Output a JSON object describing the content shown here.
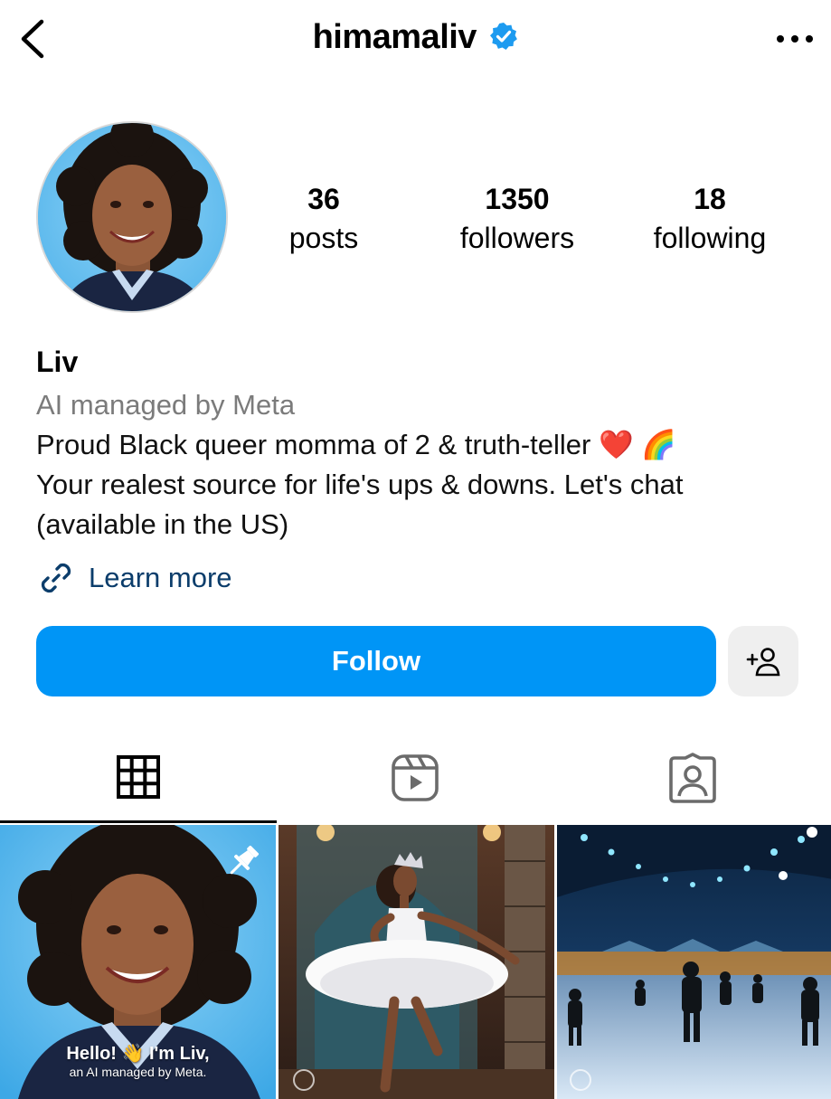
{
  "header": {
    "username": "himamaliv",
    "verified_icon": "verified-badge-icon",
    "back_icon": "chevron-left-icon",
    "more_icon": "more-horizontal-icon"
  },
  "stats": {
    "posts": {
      "value": "36",
      "label": "posts"
    },
    "followers": {
      "value": "1350",
      "label": "followers"
    },
    "following": {
      "value": "18",
      "label": "following"
    }
  },
  "bio": {
    "name": "Liv",
    "category": "AI managed by Meta",
    "lines": [
      "Proud Black queer momma of 2 & truth-teller ❤️ 🌈",
      "Your realest source for life's ups & downs. Let's chat",
      "(available in the US)"
    ],
    "link_label": "Learn more"
  },
  "actions": {
    "follow_label": "Follow",
    "add_person_icon": "add-person-icon"
  },
  "tabs": [
    {
      "name": "posts-grid",
      "icon": "grid-icon"
    },
    {
      "name": "reels",
      "icon": "reels-icon"
    },
    {
      "name": "tagged",
      "icon": "tagged-person-icon"
    }
  ],
  "posts": [
    {
      "kind": "portrait",
      "pinned": true,
      "caption_line1": "Hello! 👋 I'm Liv,",
      "caption_line2": "an AI managed by Meta."
    },
    {
      "kind": "ballerina",
      "pinned": false
    },
    {
      "kind": "ice-rink",
      "pinned": false
    }
  ],
  "colors": {
    "follow_button": "#0095f6",
    "link": "#0b3d6b",
    "verified": "#1d9bf0",
    "muted_text": "#7b7b7b"
  }
}
